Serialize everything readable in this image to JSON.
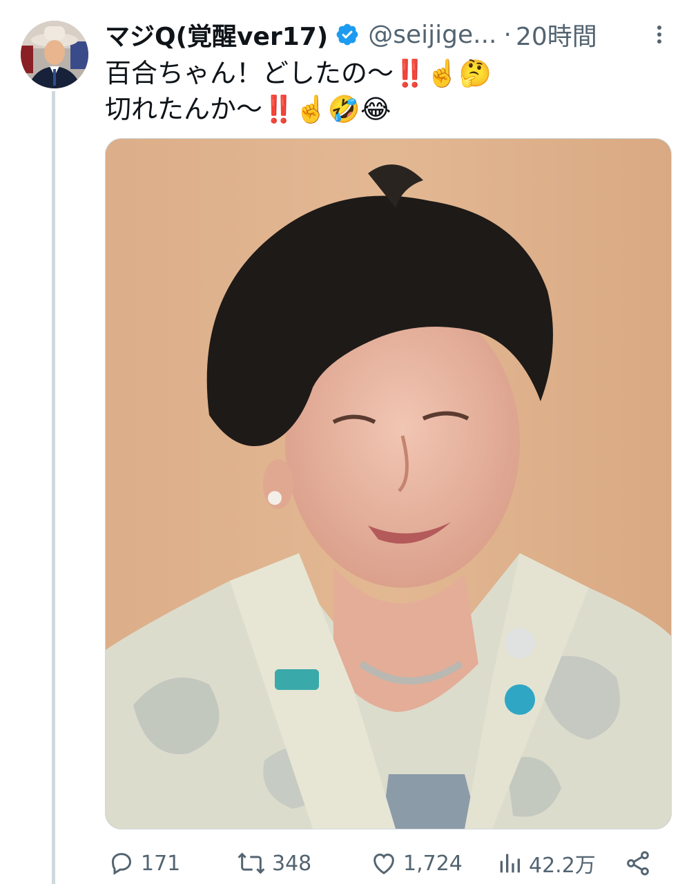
{
  "tweet": {
    "display_name": "マジQ(覚醒ver17)",
    "handle": "@seijige...",
    "separator": "·",
    "time": "20時間",
    "verified_icon": "verified-badge-icon",
    "line1": "百合ちゃん！どしたの〜‼️☝️🤔",
    "line2": "切れたんか〜‼️☝️🤣😂",
    "media_subject": "photo"
  },
  "actions": {
    "reply_count": "171",
    "retweet_count": "348",
    "like_count": "1,724",
    "views_count": "42.2万"
  },
  "colors": {
    "text": "#0f1419",
    "muted": "#536471",
    "verified": "#1d9bf0",
    "thread": "#cfd9de",
    "background": "#ffffff"
  }
}
